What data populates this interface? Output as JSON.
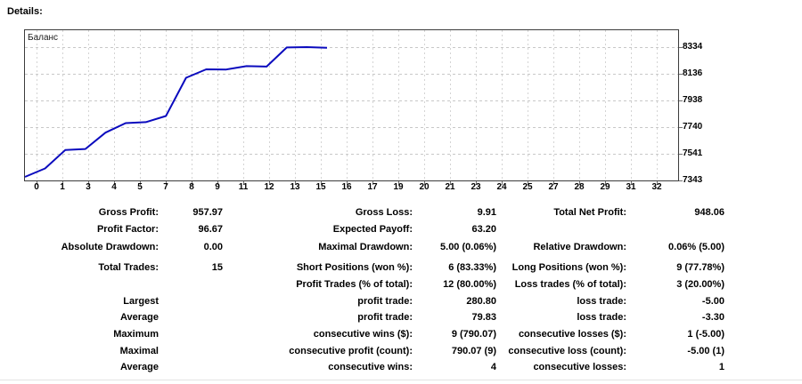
{
  "page": {
    "title": "Details:"
  },
  "chart": {
    "series_label": "Баланс",
    "line_color": "#0b0bbe",
    "border_color": "#3c3c3c",
    "hgrid_color": "#c8c8c8",
    "vgrid_color": "#d4d4d4",
    "tick_color": "#707070",
    "y_ticks": [
      "8334",
      "8136",
      "7938",
      "7740",
      "7541",
      "7343"
    ],
    "x_ticks": [
      "0",
      "1",
      "3",
      "4",
      "5",
      "7",
      "8",
      "9",
      "11",
      "12",
      "13",
      "15",
      "16",
      "17",
      "19",
      "20",
      "21",
      "23",
      "24",
      "25",
      "27",
      "28",
      "29",
      "31",
      "32"
    ]
  },
  "chart_data": {
    "type": "line",
    "title": "Баланс",
    "xlabel": "",
    "ylabel": "",
    "x": [
      0,
      1,
      2,
      3,
      4,
      5,
      6,
      7,
      8,
      9,
      10,
      11,
      12,
      13,
      14,
      15
    ],
    "balance": [
      7343.0,
      7405.0,
      7540.0,
      7548.0,
      7668.0,
      7738.0,
      7745.0,
      7790.0,
      8070.8,
      8133.07,
      8131.46,
      8156.46,
      8153.16,
      8293.16,
      8296.06,
      8291.06
    ],
    "xlim": [
      0,
      32
    ],
    "ylim": [
      7343,
      8334
    ],
    "y_gridlines": [
      8334,
      8136,
      7938,
      7740,
      7541,
      7343
    ],
    "grid": true,
    "legend_position": "top-left-inside"
  },
  "stats": {
    "rows": [
      {
        "c1_label": "Gross Profit:",
        "c1_value": "957.97",
        "c2_label": "Gross Loss:",
        "c2_value": "9.91",
        "c3_label": "Total Net Profit:",
        "c3_value": "948.06"
      },
      {
        "c1_label": "Profit Factor:",
        "c1_value": "96.67",
        "c2_label": "Expected Payoff:",
        "c2_value": "63.20",
        "c3_label": "",
        "c3_value": ""
      },
      {
        "c1_label": "Absolute Drawdown:",
        "c1_value": "0.00",
        "c2_label": "Maximal Drawdown:",
        "c2_value": "5.00 (0.06%)",
        "c3_label": "Relative Drawdown:",
        "c3_value": "0.06% (5.00)"
      },
      {
        "c1_label": "Total Trades:",
        "c1_value": "15",
        "c2_label": "Short Positions (won %):",
        "c2_value": "6 (83.33%)",
        "c3_label": "Long Positions (won %):",
        "c3_value": "9 (77.78%)"
      },
      {
        "c1_label": "",
        "c1_value": "",
        "c2_label": "Profit Trades (% of total):",
        "c2_value": "12 (80.00%)",
        "c3_label": "Loss trades (% of total):",
        "c3_value": "3 (20.00%)"
      },
      {
        "c1_label": "Largest",
        "c1_value": "",
        "c2_label": "profit trade:",
        "c2_value": "280.80",
        "c3_label": "loss trade:",
        "c3_value": "-5.00"
      },
      {
        "c1_label": "Average",
        "c1_value": "",
        "c2_label": "profit trade:",
        "c2_value": "79.83",
        "c3_label": "loss trade:",
        "c3_value": "-3.30"
      },
      {
        "c1_label": "Maximum",
        "c1_value": "",
        "c2_label": "consecutive wins ($):",
        "c2_value": "9 (790.07)",
        "c3_label": "consecutive losses ($):",
        "c3_value": "1 (-5.00)"
      },
      {
        "c1_label": "Maximal",
        "c1_value": "",
        "c2_label": "consecutive profit (count):",
        "c2_value": "790.07 (9)",
        "c3_label": "consecutive loss (count):",
        "c3_value": "-5.00 (1)"
      },
      {
        "c1_label": "Average",
        "c1_value": "",
        "c2_label": "consecutive wins:",
        "c2_value": "4",
        "c3_label": "consecutive losses:",
        "c3_value": "1"
      }
    ]
  }
}
